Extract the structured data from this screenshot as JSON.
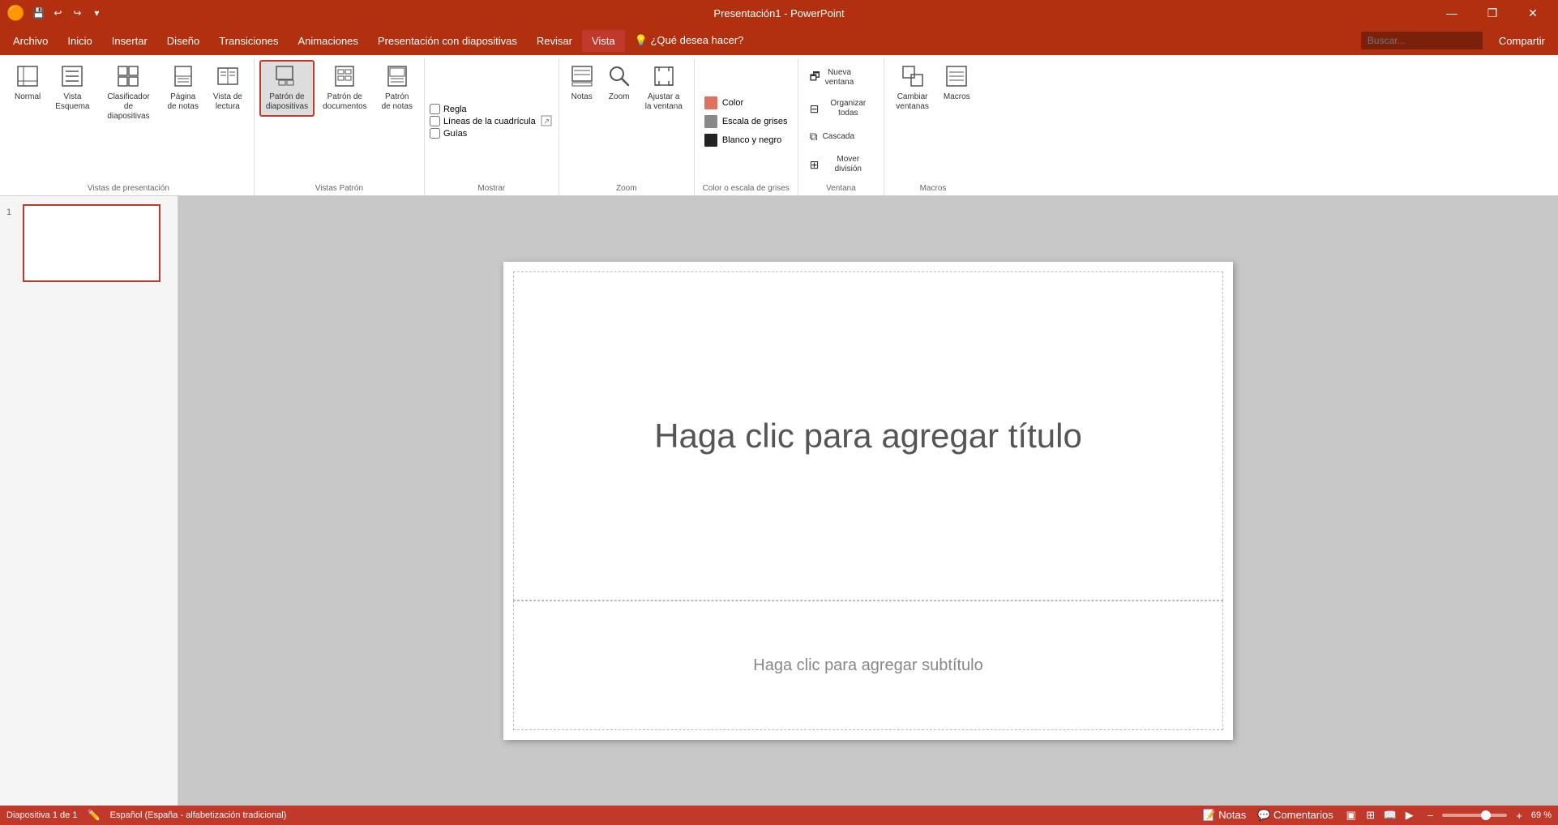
{
  "titlebar": {
    "title": "Presentación1 - PowerPoint",
    "quickaccess": {
      "save": "💾",
      "undo": "↩",
      "redo": "↪",
      "customize": "▾"
    },
    "winbtns": {
      "minimize": "—",
      "restore": "❐",
      "close": "✕"
    }
  },
  "menubar": {
    "items": [
      {
        "id": "archivo",
        "label": "Archivo"
      },
      {
        "id": "inicio",
        "label": "Inicio"
      },
      {
        "id": "insertar",
        "label": "Insertar"
      },
      {
        "id": "diseno",
        "label": "Diseño"
      },
      {
        "id": "transiciones",
        "label": "Transiciones"
      },
      {
        "id": "animaciones",
        "label": "Animaciones"
      },
      {
        "id": "presentacion",
        "label": "Presentación con diapositivas"
      },
      {
        "id": "revisar",
        "label": "Revisar"
      },
      {
        "id": "vista",
        "label": "Vista",
        "active": true
      },
      {
        "id": "help",
        "label": "💡 ¿Qué desea hacer?"
      }
    ],
    "share": "Compartir"
  },
  "ribbon": {
    "tab": "Vista",
    "groups": [
      {
        "id": "vistas-presentacion",
        "label": "Vistas de presentación",
        "items": [
          {
            "id": "normal",
            "icon": "▣",
            "label": "Normal",
            "active": false
          },
          {
            "id": "vista-esquema",
            "icon": "≡",
            "label": "Vista\nEsquema",
            "active": false
          },
          {
            "id": "clasificador",
            "icon": "⊞",
            "label": "Clasificador de\ndiapositivas",
            "active": false
          },
          {
            "id": "pagina-notas",
            "icon": "📄",
            "label": "Página\nde notas",
            "active": false
          },
          {
            "id": "vista-lectura",
            "icon": "📖",
            "label": "Vista de\nlectura",
            "active": false
          }
        ]
      },
      {
        "id": "vistas-patron",
        "label": "Vistas Patrón",
        "items": [
          {
            "id": "patron-diapositivas",
            "icon": "🗔",
            "label": "Patrón de\ndiapositivas",
            "active": true
          },
          {
            "id": "patron-documentos",
            "icon": "📋",
            "label": "Patrón de\ndocumentos",
            "active": false
          },
          {
            "id": "patron-notas",
            "icon": "📝",
            "label": "Patrón\nde notas",
            "active": false
          }
        ]
      },
      {
        "id": "mostrar",
        "label": "Mostrar",
        "checkboxes": [
          {
            "id": "regla",
            "label": "Regla",
            "checked": false
          },
          {
            "id": "lineas",
            "label": "Líneas de la cuadrícula",
            "checked": false
          },
          {
            "id": "guias",
            "label": "Guías",
            "checked": false
          }
        ]
      },
      {
        "id": "zoom",
        "label": "Zoom",
        "items": [
          {
            "id": "notas",
            "icon": "📝",
            "label": "Notas"
          },
          {
            "id": "zoom",
            "icon": "🔍",
            "label": "Zoom"
          },
          {
            "id": "ajustar",
            "icon": "⊡",
            "label": "Ajustar a\nla ventana"
          }
        ]
      },
      {
        "id": "color-escala",
        "label": "Color o escala de grises",
        "colors": [
          {
            "id": "color",
            "swatch": "#e07060",
            "label": "Color"
          },
          {
            "id": "escala-grises",
            "swatch": "#888",
            "label": "Escala de grises"
          },
          {
            "id": "blanco-negro",
            "swatch": "#222",
            "label": "Blanco y negro"
          }
        ]
      },
      {
        "id": "ventana",
        "label": "Ventana",
        "items": [
          {
            "id": "nueva-ventana",
            "icon": "🗗",
            "label": "Nueva\nventana"
          },
          {
            "id": "organizar-todas",
            "icon": "⊟",
            "label": "Organizar todas"
          },
          {
            "id": "cascada",
            "icon": "⧉",
            "label": "Cascada"
          },
          {
            "id": "mover-division",
            "icon": "⊞",
            "label": "Mover división"
          }
        ]
      },
      {
        "id": "macros-group",
        "label": "Macros",
        "items": [
          {
            "id": "cambiar-ventanas",
            "icon": "🗔",
            "label": "Cambiar\nventanas"
          },
          {
            "id": "macros",
            "icon": "▶",
            "label": "Macros"
          }
        ]
      }
    ]
  },
  "slides": [
    {
      "number": "1",
      "active": true
    }
  ],
  "canvas": {
    "title_placeholder": "Haga clic para agregar título",
    "subtitle_placeholder": "Haga clic para agregar subtítulo"
  },
  "statusbar": {
    "slide_info": "Diapositiva 1 de 1",
    "language": "Español (España - alfabetización tradicional)",
    "notes": "Notas",
    "comments": "Comentarios",
    "zoom_percent": "69 %",
    "zoom_plus": "+",
    "zoom_minus": "−"
  }
}
